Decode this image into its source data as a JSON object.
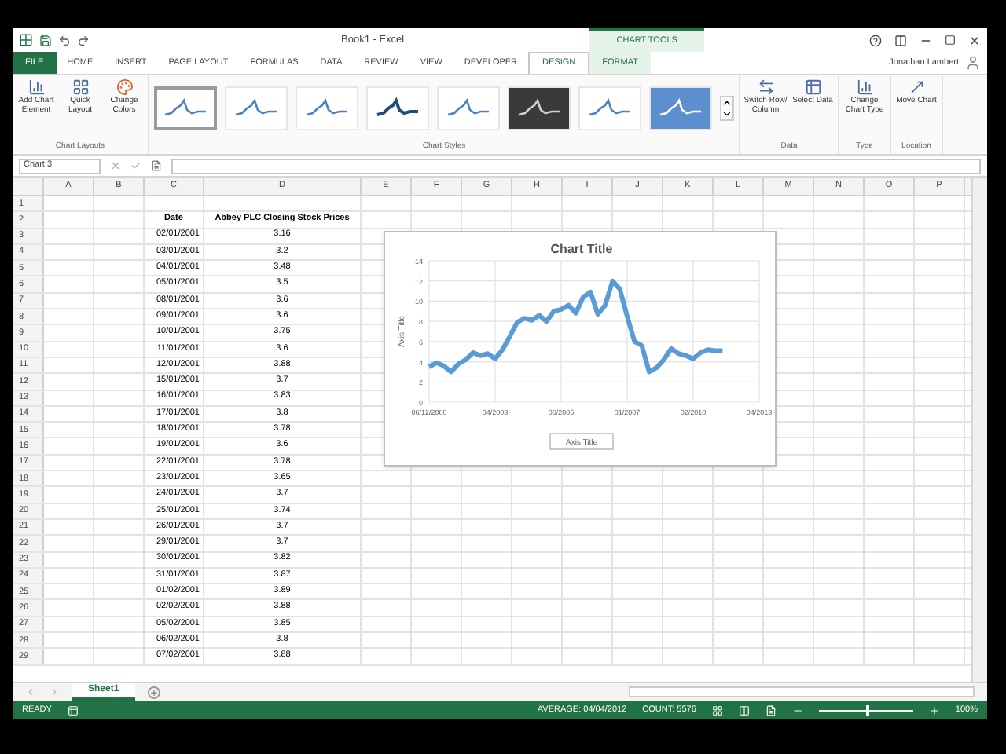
{
  "window": {
    "title": "Book1 - Excel",
    "context_label": "CHART TOOLS",
    "user": "Jonathan Lambert"
  },
  "tabs": [
    {
      "label": "FILE",
      "kind": "file",
      "selected": false
    },
    {
      "label": "HOME",
      "kind": "tab",
      "selected": false
    },
    {
      "label": "INSERT",
      "kind": "tab",
      "selected": false
    },
    {
      "label": "PAGE LAYOUT",
      "kind": "tab",
      "selected": false
    },
    {
      "label": "FORMULAS",
      "kind": "tab",
      "selected": false
    },
    {
      "label": "DATA",
      "kind": "tab",
      "selected": false
    },
    {
      "label": "REVIEW",
      "kind": "tab",
      "selected": false
    },
    {
      "label": "VIEW",
      "kind": "tab",
      "selected": false
    },
    {
      "label": "DEVELOPER",
      "kind": "tab",
      "selected": false
    },
    {
      "label": "DESIGN",
      "kind": "context",
      "selected": true
    },
    {
      "label": "FORMAT",
      "kind": "context",
      "selected": false
    }
  ],
  "ribbon": {
    "layouts_group": {
      "label": "Chart Layouts",
      "buttons": [
        {
          "label": "Add Chart Element",
          "kind": "element"
        },
        {
          "label": "Quick Layout",
          "kind": "layout"
        }
      ]
    },
    "colors_button": {
      "label": "Change Colors"
    },
    "styles_group": {
      "label": "Chart Styles",
      "styles": [
        {
          "kind": "light",
          "selected": true
        },
        {
          "kind": "light",
          "selected": false
        },
        {
          "kind": "light",
          "selected": false
        },
        {
          "kind": "bold",
          "selected": false
        },
        {
          "kind": "light",
          "selected": false
        },
        {
          "kind": "dark",
          "selected": false
        },
        {
          "kind": "light",
          "selected": false
        },
        {
          "kind": "filled",
          "selected": false
        }
      ]
    },
    "data_group": {
      "label": "Data",
      "buttons": [
        {
          "label": "Switch Row/ Column",
          "kind": "switch"
        },
        {
          "label": "Select Data",
          "kind": "select"
        }
      ]
    },
    "type_group": {
      "label": "Type",
      "buttons": [
        {
          "label": "Change Chart Type",
          "kind": "type"
        }
      ]
    },
    "location_group": {
      "label": "Location",
      "buttons": [
        {
          "label": "Move Chart",
          "kind": "move"
        }
      ]
    }
  },
  "name_box": "Chart 3",
  "columns": [
    "A",
    "B",
    "C",
    "D",
    "E",
    "F",
    "G",
    "H",
    "I",
    "J",
    "K",
    "L",
    "M",
    "N",
    "O",
    "P"
  ],
  "header_row": {
    "row": "2",
    "date": "Date",
    "price": "Abbey PLC Closing Stock Prices"
  },
  "rows": [
    {
      "row": "1",
      "date": "",
      "price": ""
    },
    {
      "row": "3",
      "date": "02/01/2001",
      "price": "3.16"
    },
    {
      "row": "4",
      "date": "03/01/2001",
      "price": "3.2"
    },
    {
      "row": "5",
      "date": "04/01/2001",
      "price": "3.48"
    },
    {
      "row": "6",
      "date": "05/01/2001",
      "price": "3.5"
    },
    {
      "row": "7",
      "date": "08/01/2001",
      "price": "3.6"
    },
    {
      "row": "8",
      "date": "09/01/2001",
      "price": "3.6"
    },
    {
      "row": "9",
      "date": "10/01/2001",
      "price": "3.75"
    },
    {
      "row": "10",
      "date": "11/01/2001",
      "price": "3.6"
    },
    {
      "row": "11",
      "date": "12/01/2001",
      "price": "3.88"
    },
    {
      "row": "12",
      "date": "15/01/2001",
      "price": "3.7"
    },
    {
      "row": "13",
      "date": "16/01/2001",
      "price": "3.83"
    },
    {
      "row": "14",
      "date": "17/01/2001",
      "price": "3.8"
    },
    {
      "row": "15",
      "date": "18/01/2001",
      "price": "3.78"
    },
    {
      "row": "16",
      "date": "19/01/2001",
      "price": "3.6"
    },
    {
      "row": "17",
      "date": "22/01/2001",
      "price": "3.78"
    },
    {
      "row": "18",
      "date": "23/01/2001",
      "price": "3.65"
    },
    {
      "row": "19",
      "date": "24/01/2001",
      "price": "3.7"
    },
    {
      "row": "20",
      "date": "25/01/2001",
      "price": "3.74"
    },
    {
      "row": "21",
      "date": "26/01/2001",
      "price": "3.7"
    },
    {
      "row": "22",
      "date": "29/01/2001",
      "price": "3.7"
    },
    {
      "row": "23",
      "date": "30/01/2001",
      "price": "3.82"
    },
    {
      "row": "24",
      "date": "31/01/2001",
      "price": "3.87"
    },
    {
      "row": "25",
      "date": "01/02/2001",
      "price": "3.89"
    },
    {
      "row": "26",
      "date": "02/02/2001",
      "price": "3.88"
    },
    {
      "row": "27",
      "date": "05/02/2001",
      "price": "3.85"
    },
    {
      "row": "28",
      "date": "06/02/2001",
      "price": "3.8"
    },
    {
      "row": "29",
      "date": "07/02/2001",
      "price": "3.88"
    }
  ],
  "chart": {
    "x_axis_labels": [
      "06/12/2000",
      "04/2003",
      "06/2005",
      "01/2007",
      "02/2010",
      "04/2013"
    ],
    "chart_data": {
      "type": "line",
      "title": "Chart Title",
      "xlabel": "Axis Title",
      "ylabel": "Axis Title",
      "ylim": [
        0,
        14
      ],
      "yticks": [
        0,
        2,
        4,
        6,
        8,
        10,
        12,
        14
      ],
      "grid": true,
      "series": [
        {
          "color": "#5b9bd5",
          "values": [
            3.5,
            3.9,
            3.6,
            3.0,
            3.8,
            4.2,
            4.9,
            4.6,
            4.8,
            4.3,
            5.2,
            6.5,
            7.9,
            8.3,
            8.1,
            8.6,
            8.0,
            9.0,
            9.2,
            9.6,
            8.8,
            10.4,
            10.9,
            8.7,
            9.6,
            12.0,
            11.2,
            8.5,
            6.0,
            5.6,
            3.0,
            3.4,
            4.2,
            5.3,
            4.8,
            4.6,
            4.3,
            4.9,
            5.2,
            5.1,
            5.1
          ]
        }
      ]
    }
  },
  "sheet_tabs": [
    {
      "label": "Sheet1",
      "selected": true
    }
  ],
  "status_bar": {
    "mode": "READY",
    "average": "AVERAGE: 04/04/2012",
    "count": "COUNT: 5576",
    "zoom": {
      "level": 0.5,
      "reading": "100%"
    }
  }
}
